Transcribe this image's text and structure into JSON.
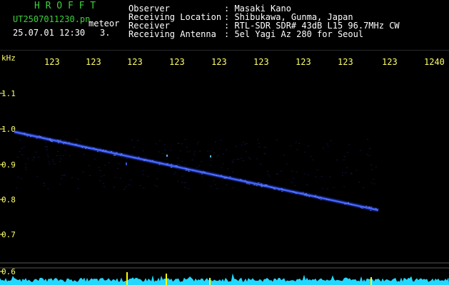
{
  "header": {
    "title_letters": "H R O F F T",
    "filename": "UT2507011230.pn",
    "tag": "meteor",
    "datetime": "25.07.01 12:30",
    "count": "3.",
    "fields": [
      {
        "label": "Observer",
        "value": ": Masaki Kano"
      },
      {
        "label": "Receiving Location",
        "value": ": Shibukawa, Gunma, Japan"
      },
      {
        "label": "Receiver",
        "value": ": RTL-SDR SDR# 43dB L15 96.7MHz CW"
      },
      {
        "label": "Receiving Antenna",
        "value": ": 5el Yagi Az 280 for Seoul"
      }
    ]
  },
  "axis": {
    "unit": "kHz",
    "time_labels": [
      "123",
      "123",
      "123",
      "123",
      "123",
      "123",
      "123",
      "123",
      "123",
      "1240"
    ],
    "freq_labels": [
      "1.1",
      "1.0",
      "0.9",
      "0.8",
      "0.7",
      "0.6"
    ]
  },
  "colors": {
    "trace": "#4466ff",
    "spectrum": "#22d8ff",
    "label": "#ffff66",
    "title": "#3cd13c",
    "ref_line": "#555555",
    "marker": "#ffff00"
  }
}
